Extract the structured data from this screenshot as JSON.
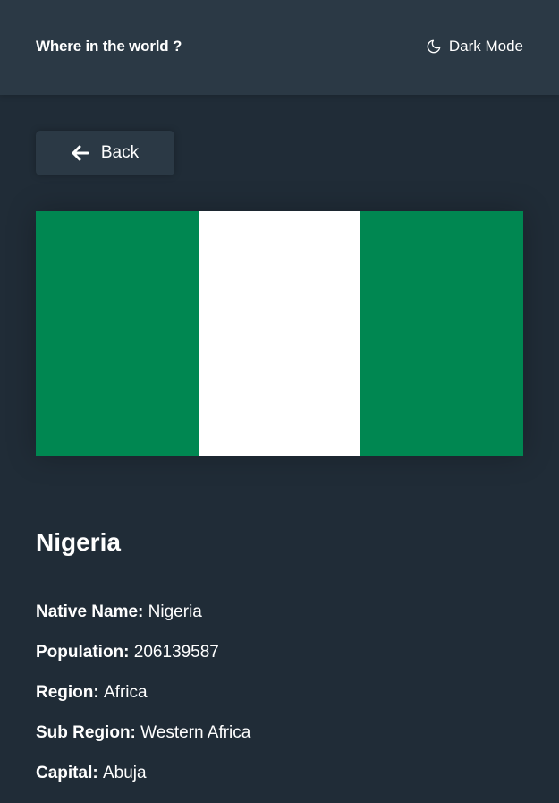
{
  "header": {
    "title": "Where in the world ?",
    "dark_mode_label": "Dark Mode",
    "toggle_icon": "moon-icon"
  },
  "back": {
    "label": "Back",
    "icon": "arrow-left-icon"
  },
  "flag": {
    "bands": [
      {
        "color": "#008751"
      },
      {
        "color": "#ffffff"
      },
      {
        "color": "#008751"
      }
    ]
  },
  "country": {
    "name": "Nigeria",
    "details": [
      {
        "label": "Native Name:",
        "value": "Nigeria"
      },
      {
        "label": "Population:",
        "value": "206139587"
      },
      {
        "label": "Region:",
        "value": "Africa"
      },
      {
        "label": "Sub Region:",
        "value": "Western Africa"
      },
      {
        "label": "Capital:",
        "value": "Abuja"
      }
    ]
  },
  "colors": {
    "background": "#202c37",
    "elements": "#2b3945",
    "text": "#ffffff"
  }
}
